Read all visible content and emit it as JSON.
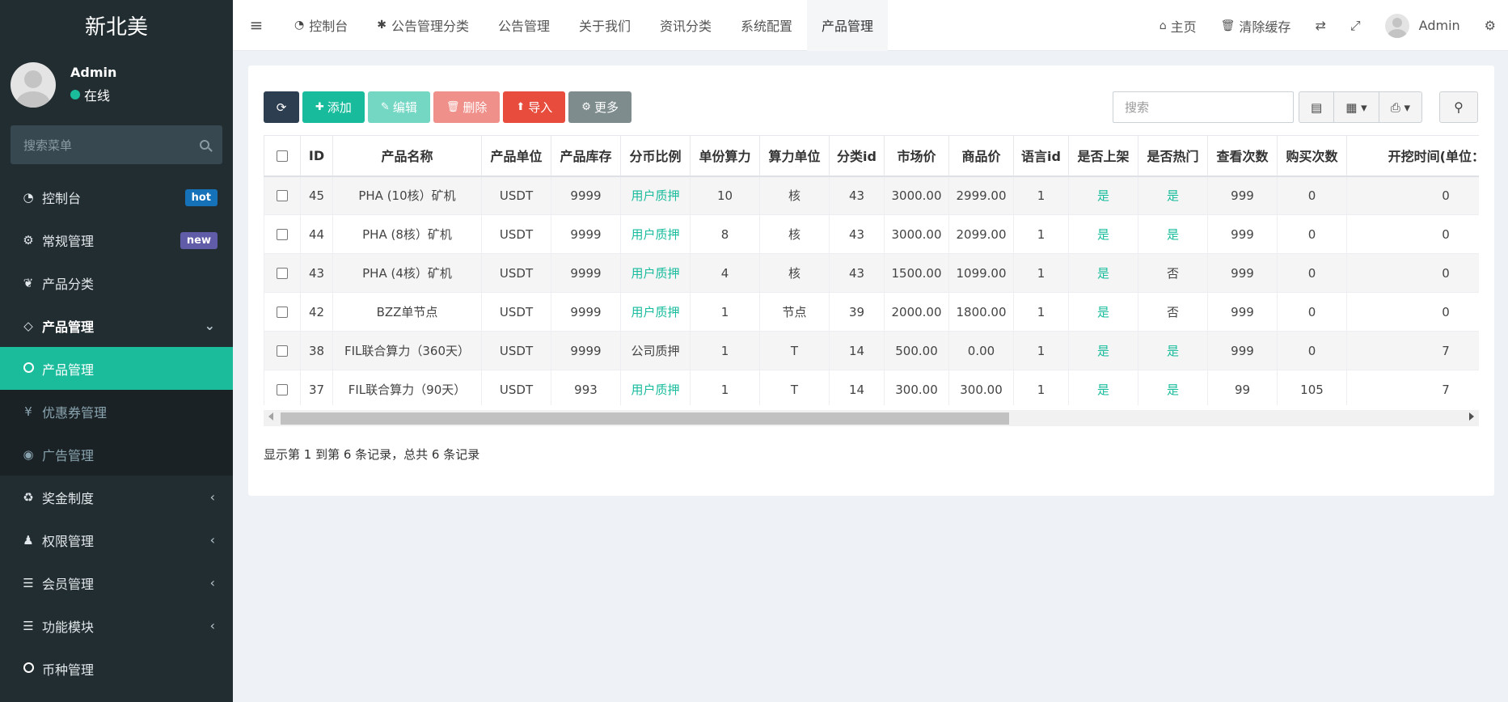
{
  "sidebar": {
    "logo": "新北美",
    "user_name": "Admin",
    "user_status": "在线",
    "search_placeholder": "搜索菜单",
    "items": [
      {
        "label": "控制台",
        "icon": "dashboard-icon",
        "glyph": "◔",
        "badge": "hot"
      },
      {
        "label": "常规管理",
        "icon": "cogs-icon",
        "glyph": "⚙",
        "badge": "new"
      },
      {
        "label": "产品分类",
        "icon": "leaf-icon",
        "glyph": "❦"
      },
      {
        "label": "产品管理",
        "icon": "diamond-icon",
        "glyph": "◇"
      },
      {
        "label": "产品管理",
        "icon": "circle-icon"
      },
      {
        "label": "优惠券管理",
        "icon": "yen-icon",
        "glyph": "¥"
      },
      {
        "label": "广告管理",
        "icon": "compass-icon",
        "glyph": "◉"
      },
      {
        "label": "奖金制度",
        "icon": "recycle-icon",
        "glyph": "♻"
      },
      {
        "label": "权限管理",
        "icon": "users-icon",
        "glyph": "♟"
      },
      {
        "label": "会员管理",
        "icon": "list-icon",
        "glyph": "☰"
      },
      {
        "label": "功能模块",
        "icon": "list-icon",
        "glyph": "☰"
      },
      {
        "label": "币种管理",
        "icon": "circle-icon"
      }
    ]
  },
  "navbar": {
    "tabs": [
      {
        "label": "控制台",
        "icon": "dashboard-icon",
        "glyph": "◔"
      },
      {
        "label": "公告管理分类",
        "icon": "asterisk-icon",
        "glyph": "✱"
      },
      {
        "label": "公告管理"
      },
      {
        "label": "关于我们"
      },
      {
        "label": "资讯分类"
      },
      {
        "label": "系统配置"
      },
      {
        "label": "产品管理"
      }
    ],
    "home": "主页",
    "clear_cache": "清除缓存",
    "admin": "Admin"
  },
  "toolbar": {
    "add": "添加",
    "edit": "编辑",
    "delete": "删除",
    "import": "导入",
    "more": "更多",
    "search_placeholder": "搜索"
  },
  "table": {
    "headers": [
      "ID",
      "产品名称",
      "产品单位",
      "产品库存",
      "分币比例",
      "单份算力",
      "算力单位",
      "分类id",
      "市场价",
      "商品价",
      "语言id",
      "是否上架",
      "是否热门",
      "查看次数",
      "购买次数",
      "开挖时间(单位：天)"
    ],
    "rows": [
      [
        "45",
        "PHA (10核）矿机",
        "USDT",
        "9999",
        "用户质押",
        "10",
        "核",
        "43",
        "3000.00",
        "2999.00",
        "1",
        "是",
        "是",
        "999",
        "0",
        "0"
      ],
      [
        "44",
        "PHA (8核）矿机",
        "USDT",
        "9999",
        "用户质押",
        "8",
        "核",
        "43",
        "3000.00",
        "2099.00",
        "1",
        "是",
        "是",
        "999",
        "0",
        "0"
      ],
      [
        "43",
        "PHA (4核）矿机",
        "USDT",
        "9999",
        "用户质押",
        "4",
        "核",
        "43",
        "1500.00",
        "1099.00",
        "1",
        "是",
        "否",
        "999",
        "0",
        "0"
      ],
      [
        "42",
        "BZZ单节点",
        "USDT",
        "9999",
        "用户质押",
        "1",
        "节点",
        "39",
        "2000.00",
        "1800.00",
        "1",
        "是",
        "否",
        "999",
        "0",
        "0"
      ],
      [
        "38",
        "FIL联合算力（360天）",
        "USDT",
        "9999",
        "公司质押",
        "1",
        "T",
        "14",
        "500.00",
        "0.00",
        "1",
        "是",
        "是",
        "999",
        "0",
        "7"
      ],
      [
        "37",
        "FIL联合算力（90天）",
        "USDT",
        "993",
        "用户质押",
        "1",
        "T",
        "14",
        "300.00",
        "300.00",
        "1",
        "是",
        "是",
        "99",
        "105",
        "7"
      ]
    ],
    "green_values": [
      "用户质押",
      "是"
    ]
  },
  "summary": "显示第 1 到第 6 条记录，总共 6 条记录",
  "colors": {
    "sidebar_bg": "#222d32",
    "accent": "#18bc9c",
    "danger": "#e74c3c",
    "dark": "#2c3e50"
  }
}
